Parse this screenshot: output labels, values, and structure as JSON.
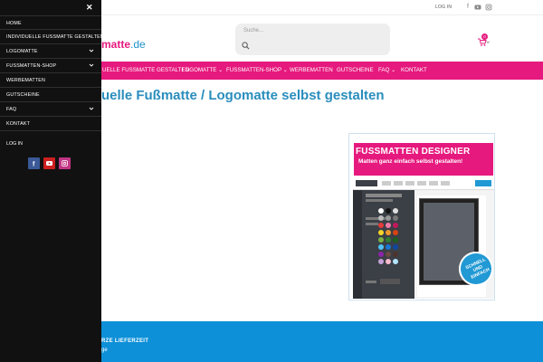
{
  "topbar": {
    "login": "LOG IN",
    "social": [
      "facebook-icon",
      "youtube-icon",
      "instagram-icon"
    ]
  },
  "header": {
    "logo_brand": "matte",
    "logo_domain": ".de",
    "search_placeholder": "Suche...",
    "cart_count": "0"
  },
  "nav": {
    "items": [
      {
        "label": "UELLE FUSSMATTE GESTALTEN",
        "dropdown": false
      },
      {
        "label": "LOGOMATTE",
        "dropdown": true
      },
      {
        "label": "FUSSMATTEN-SHOP",
        "dropdown": true
      },
      {
        "label": "WERBEMATTEN",
        "dropdown": false
      },
      {
        "label": "GUTSCHEINE",
        "dropdown": false
      },
      {
        "label": "FAQ",
        "dropdown": true
      },
      {
        "label": "KONTAKT",
        "dropdown": false
      }
    ]
  },
  "main": {
    "heading": "uelle Fußmatte / Logomatte selbst gestalten"
  },
  "banner": {
    "title": "FUSSMATTEN DESIGNER",
    "subtitle": "Matten ganz einfach selbst gestalten!",
    "badge_l1": "SCHNELL",
    "badge_l2": "UND",
    "badge_l3": "EINFACH"
  },
  "footer": {
    "line1": "RZE LIEFERZEIT",
    "line2": "ge"
  },
  "mobile_menu": {
    "items": [
      {
        "label": "HOME",
        "dropdown": false
      },
      {
        "label": "INDIVIDUELLE FUSSMATTE GESTALTEN",
        "dropdown": false
      },
      {
        "label": "LOGOMATTE",
        "dropdown": true
      },
      {
        "label": "FUSSMATTEN-SHOP",
        "dropdown": true
      },
      {
        "label": "WERBEMATTEN",
        "dropdown": false
      },
      {
        "label": "GUTSCHEINE",
        "dropdown": false
      },
      {
        "label": "FAQ",
        "dropdown": true
      },
      {
        "label": "KONTAKT",
        "dropdown": false
      }
    ],
    "login": "LOG IN",
    "social_colors": [
      "#3b5998",
      "#cd201f",
      "#c13584"
    ]
  },
  "colors": {
    "brand_pink": "#e6197e",
    "brand_blue": "#0d90d8",
    "heading_blue": "#2a8dbd"
  }
}
